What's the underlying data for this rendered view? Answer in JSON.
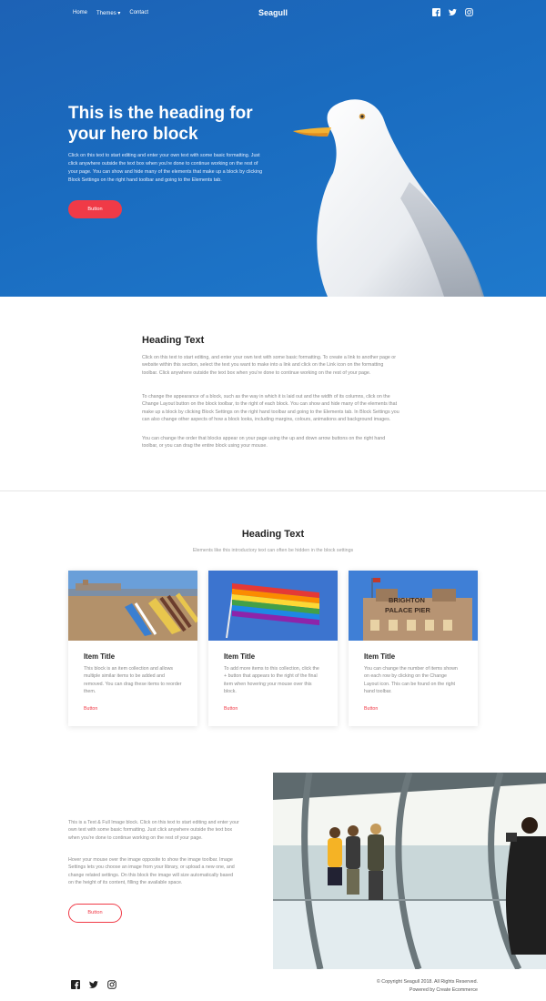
{
  "nav": {
    "items": [
      "Home",
      "Themes ▾",
      "Contact"
    ],
    "brand": "Seagull",
    "social_icons": [
      "facebook-icon",
      "twitter-icon",
      "instagram-icon"
    ]
  },
  "hero": {
    "title": "This is the heading for your hero block",
    "text": "Click on this text to start editing and enter your own text with some basic formatting. Just click anywhere outside the text box when you're done to continue working on the rest of your page. You can show and hide many of the elements that make up a block by clicking Block Settings on the right hand toolbar and going to the Elements tab.",
    "button": "Button",
    "bg_color": "#1a6cc0",
    "accent": "#f03a47"
  },
  "section1": {
    "title": "Heading Text",
    "paragraphs": [
      "Click on this text to start editing, and enter your own text with some basic formatting. To create a link to another page or website within this section, select the text you want to make into a link and click on the Link icon on the formatting toolbar. Click anywhere outside the text box when you're done to continue working on the rest of your page.",
      "To change the appearance of a block, such as the way in which it is laid out and the width of its columns, click on the Change Layout button on the block toolbar, to the right of each block. You can show and hide many of the elements that make up a block by clicking Block Settings on the right hand toolbar and going to the Elements tab. In Block Settings you can also change other aspects of how a block looks, including margins, colours, animations and background images.",
      "You can change the order that blocks appear on your page using the up and down arrow buttons on the right hand toolbar, or you can drag the entire block using your mouse."
    ]
  },
  "section2": {
    "title": "Heading Text",
    "subtitle": "Elements like this introductory text can often be hidden in the block settings",
    "cards": [
      {
        "title": "Item Title",
        "text": "This block is an item collection and allows multiple similar items to be added and removed. You can drag these items to reorder them.",
        "button": "Button"
      },
      {
        "title": "Item Title",
        "text": "To add more items to this collection, click the + button that appears to the right of the final item when hovering your mouse over this block.",
        "button": "Button"
      },
      {
        "title": "Item Title",
        "text": "You can change the number of items shown on each row by clicking on the Change Layout icon. This can be found on the right hand toolbar.",
        "button": "Button"
      }
    ],
    "pier_sign": "BRIGHTON PALACE PIER"
  },
  "section3": {
    "paragraphs": [
      "This is a Text & Full Image block. Click on this text to start editing and enter your own text with some basic formatting. Just click anywhere outside the text box when you're done to continue working on the rest of your page.",
      "Hover your mouse over the image opposite to show the image toolbar. Image Settings lets you choose an image from your library, or upload a new one, and change related settings. On this block the image will size automatically based on the height of its content, filling the available space."
    ],
    "button": "Button"
  },
  "footer": {
    "copyright": "© Copyright Seagull 2018. All Rights Reserved.",
    "powered": "Powered by Create Ecommerce",
    "social_icons": [
      "facebook-icon",
      "twitter-icon",
      "instagram-icon"
    ]
  }
}
